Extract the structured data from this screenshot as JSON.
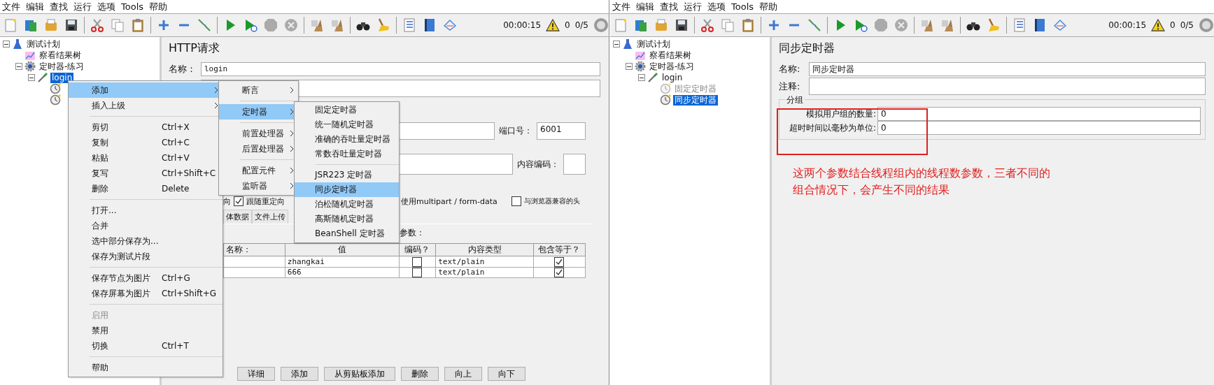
{
  "windows": [
    {
      "menu_bar": [
        "文件",
        "编辑",
        "查找",
        "运行",
        "选项",
        "Tools",
        "帮助"
      ],
      "status": {
        "elapsed": "00:00:15",
        "warnings": "0",
        "threads": "0/5"
      },
      "tree": [
        {
          "label": "测试计划",
          "kind": "plan",
          "expanded": true,
          "selected": false,
          "disabled": false,
          "children": [
            {
              "label": "察看结果树",
              "kind": "listener",
              "selected": false,
              "disabled": false
            },
            {
              "label": "定时器-练习",
              "kind": "thread_group",
              "expanded": true,
              "selected": false,
              "disabled": false,
              "children": [
                {
                  "label": "login",
                  "kind": "sampler",
                  "expanded": true,
                  "selected": true,
                  "disabled": false,
                  "children": [
                    {
                      "kind": "timer",
                      "selected": false,
                      "disabled": false
                    },
                    {
                      "kind": "timer",
                      "selected": false,
                      "disabled": false
                    }
                  ]
                }
              ]
            }
          ]
        }
      ],
      "editor": {
        "kind": "http_request",
        "title": "HTTP请求",
        "name_label": "名称：",
        "name_value": "login",
        "port_label": "端口号：",
        "port_value": "6001",
        "encoding_label": "内容编码：",
        "redirect_fragment": "向",
        "follow_redirects": {
          "label": "跟随重定向",
          "checked": true
        },
        "multipart_label": "使用multipart / form-data",
        "browser_headers": {
          "label": "与浏览器兼容的头",
          "checked": false
        },
        "tabs": [
          {
            "label": "体数据",
            "selected": false
          },
          {
            "label": "文件上传",
            "selected": false
          }
        ],
        "params_label": "参数：",
        "columns": [
          "名称：",
          "值",
          "编码？",
          "内容类型",
          "包含等于？"
        ],
        "rows": [
          {
            "value": "zhangkai",
            "encode": false,
            "content_type": "text/plain",
            "include_equals": true
          },
          {
            "value": "666",
            "encode": false,
            "content_type": "text/plain",
            "include_equals": true
          }
        ],
        "buttons": [
          "详细",
          "添加",
          "从剪贴板添加",
          "删除",
          "向上",
          "向下"
        ]
      },
      "context_menu": [
        {
          "kind": "item",
          "label": "添加",
          "selected": true,
          "disabled": false,
          "submenu": true
        },
        {
          "kind": "item",
          "label": "插入上级",
          "selected": false,
          "disabled": false,
          "submenu": true
        },
        {
          "kind": "separator"
        },
        {
          "kind": "item",
          "label": "剪切",
          "shortcut": "Ctrl+X",
          "selected": false,
          "disabled": false,
          "submenu": false
        },
        {
          "kind": "item",
          "label": "复制",
          "shortcut": "Ctrl+C",
          "selected": false,
          "disabled": false,
          "submenu": false
        },
        {
          "kind": "item",
          "label": "粘贴",
          "shortcut": "Ctrl+V",
          "selected": false,
          "disabled": false,
          "submenu": false
        },
        {
          "kind": "item",
          "label": "复写",
          "shortcut": "Ctrl+Shift+C",
          "selected": false,
          "disabled": false,
          "submenu": false
        },
        {
          "kind": "item",
          "label": "删除",
          "shortcut": "Delete",
          "selected": false,
          "disabled": false,
          "submenu": false
        },
        {
          "kind": "separator"
        },
        {
          "kind": "item",
          "label": "打开...",
          "selected": false,
          "disabled": false,
          "submenu": false
        },
        {
          "kind": "item",
          "label": "合并",
          "selected": false,
          "disabled": false,
          "submenu": false
        },
        {
          "kind": "item",
          "label": "选中部分保存为...",
          "selected": false,
          "disabled": false,
          "submenu": false
        },
        {
          "kind": "item",
          "label": "保存为测试片段",
          "selected": false,
          "disabled": false,
          "submenu": false
        },
        {
          "kind": "separator"
        },
        {
          "kind": "item",
          "label": "保存节点为图片",
          "shortcut": "Ctrl+G",
          "selected": false,
          "disabled": false,
          "submenu": false
        },
        {
          "kind": "item",
          "label": "保存屏幕为图片",
          "shortcut": "Ctrl+Shift+G",
          "selected": false,
          "disabled": false,
          "submenu": false
        },
        {
          "kind": "separator"
        },
        {
          "kind": "item",
          "label": "启用",
          "selected": false,
          "disabled": true,
          "submenu": false
        },
        {
          "kind": "item",
          "label": "禁用",
          "selected": false,
          "disabled": false,
          "submenu": false
        },
        {
          "kind": "item",
          "label": "切换",
          "shortcut": "Ctrl+T",
          "selected": false,
          "disabled": false,
          "submenu": false
        },
        {
          "kind": "separator"
        },
        {
          "kind": "item",
          "label": "帮助",
          "selected": false,
          "disabled": false,
          "submenu": false
        }
      ],
      "submenus": [
        [
          {
            "kind": "item",
            "label": "断言",
            "selected": false,
            "submenu": true
          },
          {
            "kind": "separator"
          },
          {
            "kind": "item",
            "label": "定时器",
            "selected": true,
            "submenu": true
          },
          {
            "kind": "separator"
          },
          {
            "kind": "item",
            "label": "前置处理器",
            "selected": false,
            "submenu": true
          },
          {
            "kind": "item",
            "label": "后置处理器",
            "selected": false,
            "submenu": true
          },
          {
            "kind": "separator"
          },
          {
            "kind": "item",
            "label": "配置元件",
            "selected": false,
            "submenu": true
          },
          {
            "kind": "item",
            "label": "监听器",
            "selected": false,
            "submenu": true
          }
        ],
        [
          {
            "kind": "item",
            "label": "固定定时器",
            "selected": false
          },
          {
            "kind": "item",
            "label": "统一随机定时器",
            "selected": false
          },
          {
            "kind": "item",
            "label": "准确的吞吐量定时器",
            "selected": false
          },
          {
            "kind": "item",
            "label": "常数吞吐量定时器",
            "selected": false
          },
          {
            "kind": "separator"
          },
          {
            "kind": "item",
            "label": "JSR223 定时器",
            "selected": false
          },
          {
            "kind": "item",
            "label": "同步定时器",
            "selected": true
          },
          {
            "kind": "item",
            "label": "泊松随机定时器",
            "selected": false
          },
          {
            "kind": "item",
            "label": "高斯随机定时器",
            "selected": false
          },
          {
            "kind": "item",
            "label": "BeanShell 定时器",
            "selected": false
          }
        ]
      ]
    },
    {
      "menu_bar": [
        "文件",
        "编辑",
        "查找",
        "运行",
        "选项",
        "Tools",
        "帮助"
      ],
      "status": {
        "elapsed": "00:00:15",
        "warnings": "0",
        "threads": "0/5"
      },
      "tree": [
        {
          "label": "测试计划",
          "kind": "plan",
          "expanded": true,
          "selected": false,
          "disabled": false,
          "children": [
            {
              "label": "察看结果树",
              "kind": "listener",
              "selected": false,
              "disabled": false
            },
            {
              "label": "定时器-练习",
              "kind": "thread_group",
              "expanded": true,
              "selected": false,
              "disabled": false,
              "children": [
                {
                  "label": "login",
                  "kind": "sampler",
                  "expanded": true,
                  "selected": false,
                  "disabled": false,
                  "children": [
                    {
                      "label": "固定定时器",
                      "kind": "timer",
                      "selected": false,
                      "disabled": true
                    },
                    {
                      "label": "同步定时器",
                      "kind": "timer",
                      "selected": true,
                      "disabled": false
                    }
                  ]
                }
              ]
            }
          ]
        }
      ],
      "editor": {
        "kind": "sync_timer",
        "title": "同步定时器",
        "name_label": "名称:",
        "name_value": "同步定时器",
        "comment_label": "注释:",
        "group_title": "分组",
        "fields": [
          {
            "label": "模拟用户组的数量:",
            "value": "0"
          },
          {
            "label": "超时时间以毫秒为单位:",
            "value": "0"
          }
        ],
        "annotation": [
          "这两个参数结合线程组内的线程数参数，三者不同的",
          "组合情况下，会产生不同的结果"
        ]
      }
    }
  ]
}
